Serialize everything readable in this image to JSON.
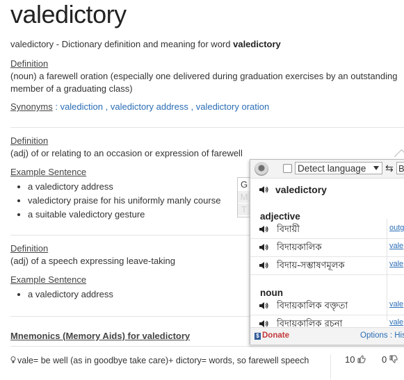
{
  "word": "valedictory",
  "intro": {
    "prefix": "valedictory - Dictionary definition and meaning for word ",
    "bold_word": "valedictory"
  },
  "definitions": [
    {
      "label": "Definition",
      "text_line1": "(noun) a farewell oration (especially one delivered during graduation exercises by an outstanding",
      "text_line2": "member of a graduating class)",
      "synonyms_label": "Synonyms",
      "synonyms": [
        "valediction",
        "valedictory address",
        "valedictory oration"
      ]
    },
    {
      "label": "Definition",
      "text": "(adj) of or relating to an occasion or expression of farewell",
      "example_label": "Example Sentence",
      "examples": [
        "a valedictory address",
        "valedictory praise for his uniformly manly course",
        "a suitable valedictory gesture"
      ]
    },
    {
      "label": "Definition",
      "text": "(adj) of a speech expressing leave-taking",
      "example_label": "Example Sentence",
      "examples": [
        "a valedictory address"
      ]
    }
  ],
  "mnemonics": {
    "title": "Mnemonics (Memory Aids) for valedictory",
    "text": "vale= be well (as in goodbye take care)+ dictory= words, so farewell speech",
    "up_votes": "10",
    "down_votes": "0"
  },
  "popup": {
    "detect_language": "Detect language",
    "target_lang": "B",
    "gmt": [
      "G",
      "M",
      "T"
    ],
    "word": "valedictory",
    "sections": [
      {
        "pos": "adjective",
        "rows": [
          {
            "bn": "বিদায়ী",
            "back": "outg"
          },
          {
            "bn": "বিদায়কালিক",
            "back": "vale"
          },
          {
            "bn": "বিদায়-সম্ভাষণমূলক",
            "back": "vale"
          }
        ]
      },
      {
        "pos": "noun",
        "rows": [
          {
            "bn": "বিদায়কালিক বক্তৃতা",
            "back": "vale"
          },
          {
            "bn": "বিদায়কালিক রচনা",
            "back": "vale"
          }
        ]
      }
    ],
    "donate": "Donate",
    "options": "Options : His"
  },
  "colors": {
    "link": "#2a6db5",
    "donate": "#c4393b",
    "text": "#333333"
  },
  "icons": [
    "speaker-icon",
    "lightbulb-icon",
    "thumbs-up-icon",
    "thumbs-down-icon",
    "swap-icon",
    "chevron-down-icon",
    "donate-icon"
  ]
}
